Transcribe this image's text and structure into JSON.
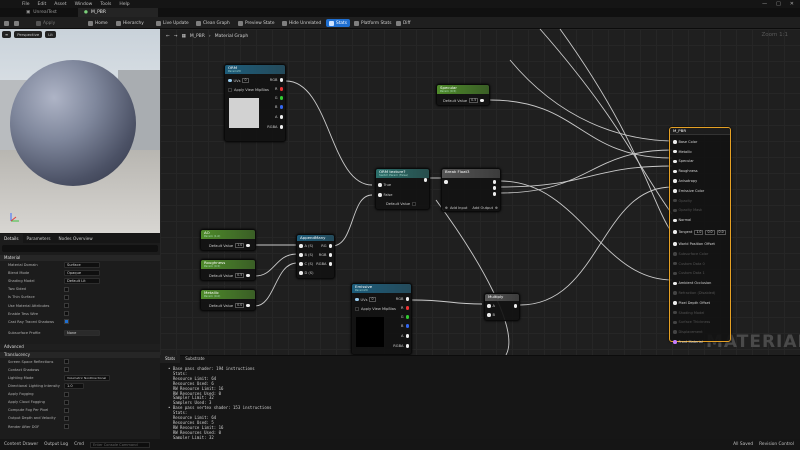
{
  "menu": [
    "File",
    "Edit",
    "Asset",
    "Window",
    "Tools",
    "Help"
  ],
  "tabs": [
    {
      "label": "UnrealTest"
    },
    {
      "label": "M_PBR"
    }
  ],
  "toolbar": {
    "save": "Save",
    "apply": "Apply",
    "home": "Home",
    "hierarchy": "Hierarchy",
    "live_update": "Live Update",
    "clean_graph": "Clean Graph",
    "preview_state": "Preview State",
    "hide_unrelated": "Hide Unrelated",
    "stats": "Stats",
    "platform_stats": "Platform Stats",
    "diff": "Diff"
  },
  "viewport": {
    "perspective": "Perspective",
    "lit": "Lit"
  },
  "graph": {
    "breadcrumb_root": "M_PBR",
    "breadcrumb_leaf": "Material Graph",
    "zoom": "Zoom 1:1",
    "watermark": "MATERIAL"
  },
  "details": {
    "tabs": [
      "Details",
      "Parameters",
      "Nodes Overview"
    ],
    "material_section": "Material",
    "rows": [
      {
        "label": "Material Domain",
        "value": "Surface"
      },
      {
        "label": "Blend Mode",
        "value": "Opaque"
      },
      {
        "label": "Shading Model",
        "value": "Default Lit"
      },
      {
        "label": "Two Sided",
        "value": ""
      },
      {
        "label": "Is Thin Surface",
        "value": ""
      },
      {
        "label": "Use Material Attributes",
        "value": ""
      },
      {
        "label": "Enable Tess Wire",
        "value": ""
      },
      {
        "label": "Cast Ray Traced Shadows",
        "value": ""
      },
      {
        "label": "Subsurface Profile",
        "value": "None"
      }
    ],
    "advanced": "Advanced",
    "translucency_section": "Translucency",
    "trows": [
      {
        "label": "Screen Space Reflections",
        "value": ""
      },
      {
        "label": "Contact Shadows",
        "value": ""
      },
      {
        "label": "Lighting Mode",
        "value": "Volumetric NonDirectional"
      },
      {
        "label": "Directional Lighting Intensity",
        "value": "1.0"
      },
      {
        "label": "Apply Fogging",
        "value": ""
      },
      {
        "label": "Apply Cloud Fogging",
        "value": ""
      },
      {
        "label": "Compute Fog Per Pixel",
        "value": ""
      },
      {
        "label": "Output Depth and Velocity",
        "value": ""
      },
      {
        "label": "Render After DOF",
        "value": ""
      }
    ]
  },
  "nodes": {
    "orm": {
      "title": "ORM",
      "subtitle": "Param2D",
      "uvs": "UVs",
      "uvs_val": "0",
      "mip": "Apply View MipBias",
      "outs": [
        "RGB",
        "R",
        "G",
        "B",
        "A",
        "RGBA"
      ]
    },
    "specular": {
      "title": "Specular",
      "subtitle": "Param (0.5)",
      "default": "Default Value",
      "val": "0.5"
    },
    "switch": {
      "title": "ORM texture?",
      "subtitle": "Switch Param (False)",
      "true": "True",
      "false": "False",
      "default": "Default Value"
    },
    "break": {
      "title": "Break Float3",
      "add_input": "Add Input",
      "add_output": "Add Output"
    },
    "ao": {
      "title": "AO",
      "subtitle": "Param (1.0)",
      "default": "Default Value",
      "val": "1.0"
    },
    "roughness": {
      "title": "Roughness",
      "subtitle": "Param (0.5)",
      "default": "Default Value",
      "val": "0.5"
    },
    "metallic": {
      "title": "Metallic",
      "subtitle": "Param (0.0)",
      "default": "Default Value",
      "val": "0.0"
    },
    "append": {
      "title": "AppendMany",
      "ins": [
        "A (S)",
        "B (S)",
        "C (S)",
        "D (S)"
      ],
      "outs": [
        "RG",
        "RGB",
        "RGBA"
      ]
    },
    "emissive": {
      "title": "Emissive",
      "subtitle": "Param2D",
      "uvs": "UVs",
      "uvs_val": "0",
      "mip": "Apply View MipBias",
      "outs": [
        "RGB",
        "R",
        "G",
        "B",
        "A",
        "RGBA"
      ]
    },
    "multiply": {
      "title": "Multiply",
      "a": "A",
      "b": "B",
      "b_val": "B"
    },
    "result": {
      "title": "M_PBR",
      "pins": [
        "Base Color",
        "Metallic",
        "Specular",
        "Roughness",
        "Anisotropy",
        "Emissive Color",
        "Opacity",
        "Opacity Mask",
        "Normal",
        "Tangent",
        "World Position Offset",
        "Subsurface Color",
        "Custom Data 0",
        "Custom Data 1",
        "Ambient Occlusion",
        "Refraction (Disabled)",
        "Pixel Depth Offset",
        "Shading Model",
        "Surface Thickness",
        "Displacement",
        "Front Material"
      ],
      "tangent_vals": [
        "1.0",
        "0.0",
        "0.0"
      ]
    }
  },
  "stats_panel": {
    "tabs": [
      "Stats",
      "Substrate"
    ],
    "lines": [
      "• Base pass shader: 194 instructions",
      "  Stats:",
      "  Resource Limit: 64",
      "  Resources Used: 6",
      "  RW Resource Limit: 16",
      "  RW Resources Used: 0",
      "  Sampler Limit: 32",
      "  Samplers Used: 3",
      "• Base pass vertex shader: 153 instructions",
      "  Stats:",
      "  Resource Limit: 64",
      "  Resources Used: 5",
      "  RW Resource Limit: 16",
      "  RW Resources Used: 0",
      "  Sampler Limit: 32"
    ]
  },
  "statusbar": {
    "content_drawer": "Content Drawer",
    "output_log": "Output Log",
    "cmd": "Cmd",
    "cmd_placeholder": "Enter Console Command",
    "all_saved": "All Saved",
    "revision_control": "Revision Control"
  }
}
